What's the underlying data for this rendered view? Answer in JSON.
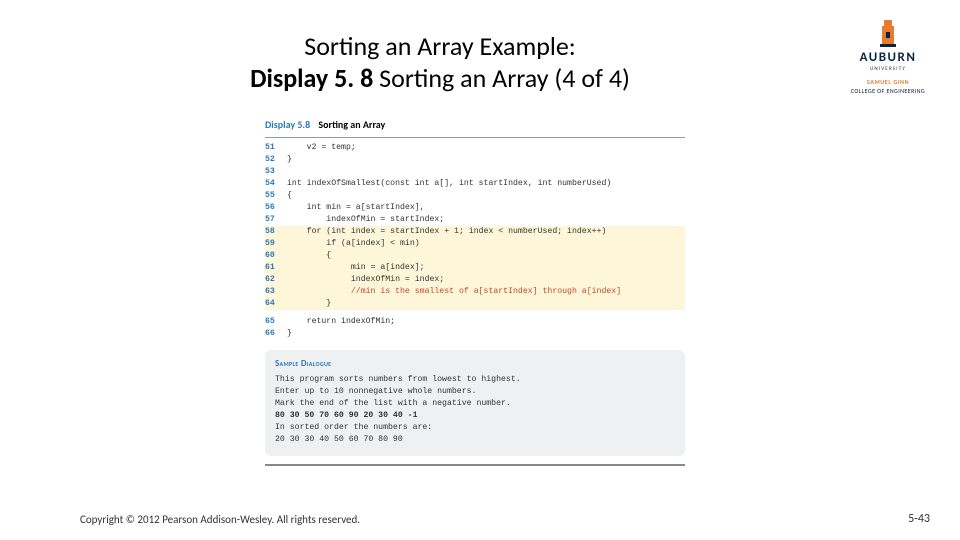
{
  "title": {
    "line1": "Sorting an Array Example:",
    "bold": "Display 5. 8",
    "rest": "  Sorting an Array (4 of 4)"
  },
  "logo": {
    "word": "AUBURN",
    "univ": "UNIVERSITY",
    "sub1": "SAMUEL GINN",
    "sub2": "COLLEGE OF ENGINEERING"
  },
  "figure": {
    "display_num": "Display 5.8",
    "display_title": "Sorting an Array",
    "lines": [
      {
        "n": "51",
        "t": "    v2 = temp;",
        "hl": false
      },
      {
        "n": "52",
        "t": "}",
        "hl": false
      },
      {
        "n": "53",
        "t": "",
        "hl": false
      },
      {
        "n": "54",
        "t": "int indexOfSmallest(const int a[], int startIndex, int numberUsed)",
        "hl": false
      },
      {
        "n": "55",
        "t": "{",
        "hl": false
      },
      {
        "n": "56",
        "t": "    int min = a[startIndex],",
        "hl": false
      },
      {
        "n": "57",
        "t": "        indexOfMin = startIndex;",
        "hl": false
      },
      {
        "n": "58",
        "t": "    for (int index = startIndex + 1; index < numberUsed; index++)",
        "hl": true
      },
      {
        "n": "59",
        "t": "        if (a[index] < min)",
        "hl": true
      },
      {
        "n": "60",
        "t": "        {",
        "hl": true
      },
      {
        "n": "61",
        "t": "             min = a[index];",
        "hl": true
      },
      {
        "n": "62",
        "t": "             indexOfMin = index;",
        "hl": true
      },
      {
        "n": "63",
        "t": "             //min is the smallest of a[startIndex] through a[index]",
        "hl": true,
        "comment": true
      },
      {
        "n": "64",
        "t": "        }",
        "hl": true
      },
      {
        "n": "65",
        "t": "    return indexOfMin;",
        "hl": false,
        "gap": true
      },
      {
        "n": "66",
        "t": "}",
        "hl": false
      }
    ]
  },
  "sample": {
    "heading": "Sample Dialogue",
    "l1": "This program sorts numbers from lowest to highest.",
    "l2": "Enter up to 10 nonnegative whole numbers.",
    "l3": "Mark the end of the list with a negative number.",
    "l4": "80 30 50 70 60 90 20 30 40 -1",
    "l5": "In sorted order the numbers are:",
    "l6": "20 30 30 40 50 60 70 80 90"
  },
  "footer": {
    "copyright": "Copyright © 2012 Pearson Addison-Wesley. All rights reserved.",
    "pagenum": "5-43"
  }
}
